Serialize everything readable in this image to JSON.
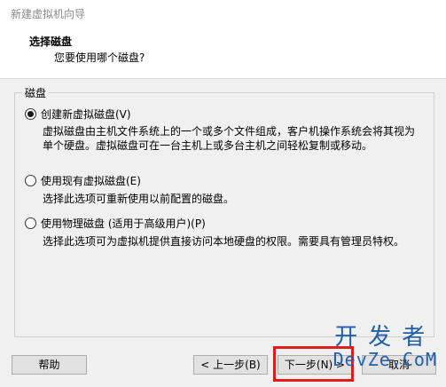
{
  "window": {
    "title": "新建虚拟机向导"
  },
  "header": {
    "title": "选择磁盘",
    "subtitle": "您要使用哪个磁盘?"
  },
  "group": {
    "legend": "磁盘",
    "options": [
      {
        "label": "创建新虚拟磁盘(V)",
        "checked": true,
        "description": "虚拟磁盘由主机文件系统上的一个或多个文件组成，客户机操作系统会将其视为单个硬盘。虚拟磁盘可在一台主机上或多台主机之间轻松复制或移动。"
      },
      {
        "label": "使用现有虚拟磁盘(E)",
        "checked": false,
        "description": "选择此选项可重新使用以前配置的磁盘。"
      },
      {
        "label": "使用物理磁盘 (适用于高级用户)(P)",
        "checked": false,
        "description": "选择此选项可为虚拟机提供直接访问本地硬盘的权限。需要具有管理员特权。"
      }
    ]
  },
  "buttons": {
    "help": "帮助",
    "back": "< 上一步(B)",
    "next": "下一步(N) >",
    "cancel": "取消"
  },
  "watermark": {
    "line1": "开发者",
    "line2": "DevZe.CoM"
  },
  "colors": {
    "highlight": "#e21b1b",
    "watermark": "#1f5fae"
  }
}
